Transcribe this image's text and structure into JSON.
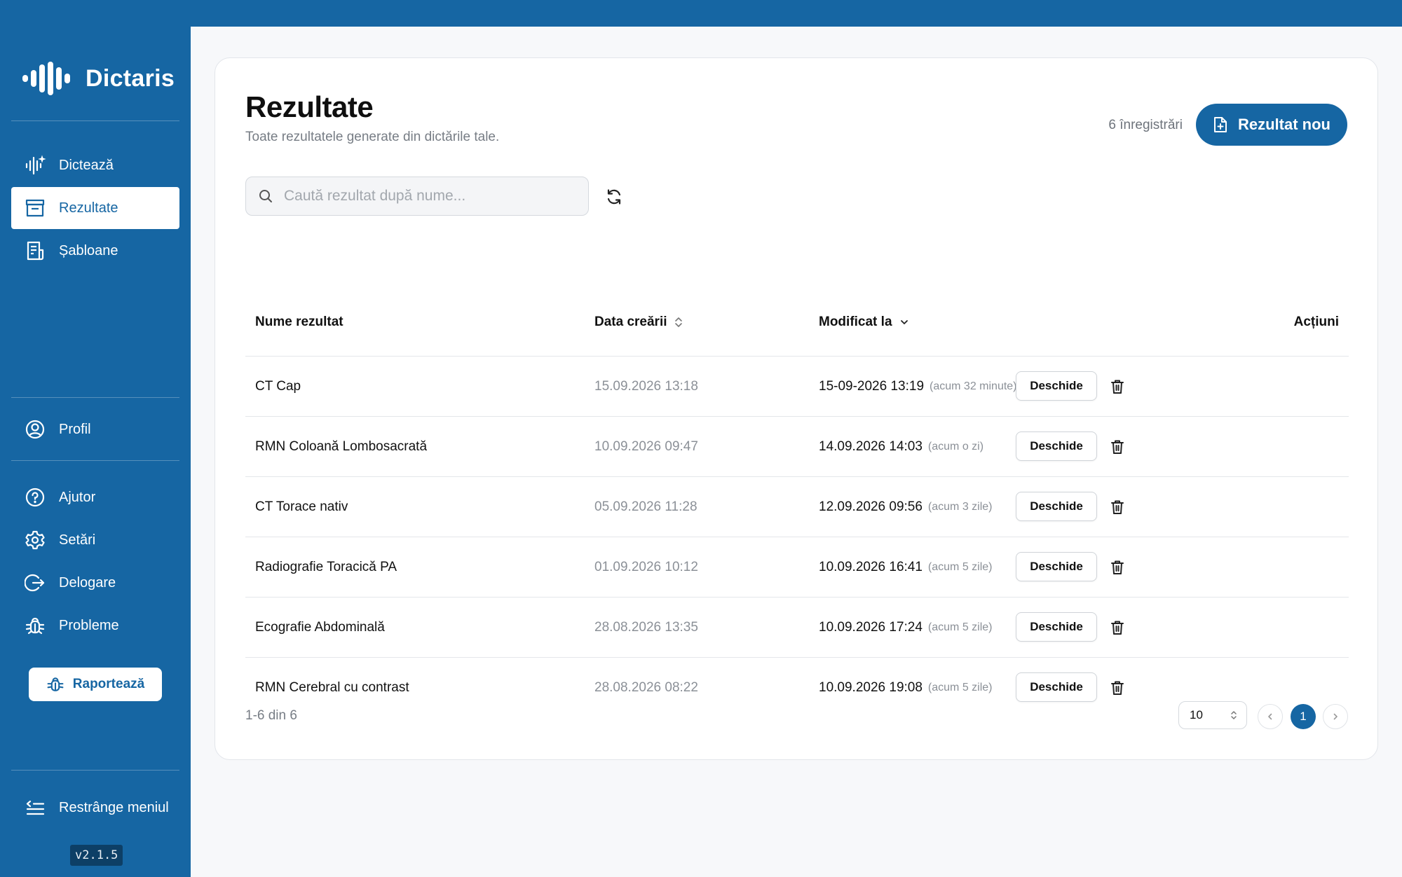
{
  "app": {
    "name": "Dictaris",
    "version": "v2.1.5",
    "accent": "#1666a3"
  },
  "sidebar": {
    "nav": [
      {
        "label": "Dictează",
        "icon": "dictate-icon"
      },
      {
        "label": "Rezultate",
        "icon": "results-icon",
        "active": true
      },
      {
        "label": "Șabloane",
        "icon": "templates-icon"
      }
    ],
    "profile": {
      "label": "Profil",
      "icon": "profile-icon"
    },
    "support": [
      {
        "label": "Ajutor",
        "icon": "help-icon"
      },
      {
        "label": "Setări",
        "icon": "settings-icon"
      },
      {
        "label": "Delogare",
        "icon": "logout-icon"
      },
      {
        "label": "Probleme",
        "icon": "bug-icon"
      }
    ],
    "report_label": "Raportează",
    "collapse_label": "Restrânge meniul"
  },
  "header": {
    "title": "Rezultate",
    "subtitle": "Toate rezultatele generate din dictările tale.",
    "count": "6 înregistrări",
    "new_label": "Rezultat nou"
  },
  "search": {
    "placeholder": "Caută rezultat după nume...",
    "value": ""
  },
  "table": {
    "columns": [
      "Nume rezultat",
      "Data creării",
      "Modificat la",
      "Acțiuni"
    ],
    "open_label": "Deschide",
    "rows": [
      {
        "name": "CT Cap",
        "created": "15.09.2026 13:18",
        "modified": "15-09-2026 13:19",
        "ago": "(acum 32 minute)"
      },
      {
        "name": "RMN Coloană Lombosacrată",
        "created": "10.09.2026 09:47",
        "modified": "14.09.2026 14:03",
        "ago": "(acum o zi)"
      },
      {
        "name": "CT Torace nativ",
        "created": "05.09.2026 11:28",
        "modified": "12.09.2026 09:56",
        "ago": "(acum 3 zile)"
      },
      {
        "name": "Radiografie Toracică PA",
        "created": "01.09.2026 10:12",
        "modified": "10.09.2026 16:41",
        "ago": "(acum 5 zile)"
      },
      {
        "name": "Ecografie Abdominală",
        "created": "28.08.2026 13:35",
        "modified": "10.09.2026 17:24",
        "ago": "(acum 5 zile)"
      },
      {
        "name": "RMN Cerebral cu contrast",
        "created": "28.08.2026 08:22",
        "modified": "10.09.2026 19:08",
        "ago": "(acum 5 zile)"
      }
    ]
  },
  "pagination": {
    "range": "1-6 din 6",
    "per_page": "10",
    "current_page": "1"
  }
}
